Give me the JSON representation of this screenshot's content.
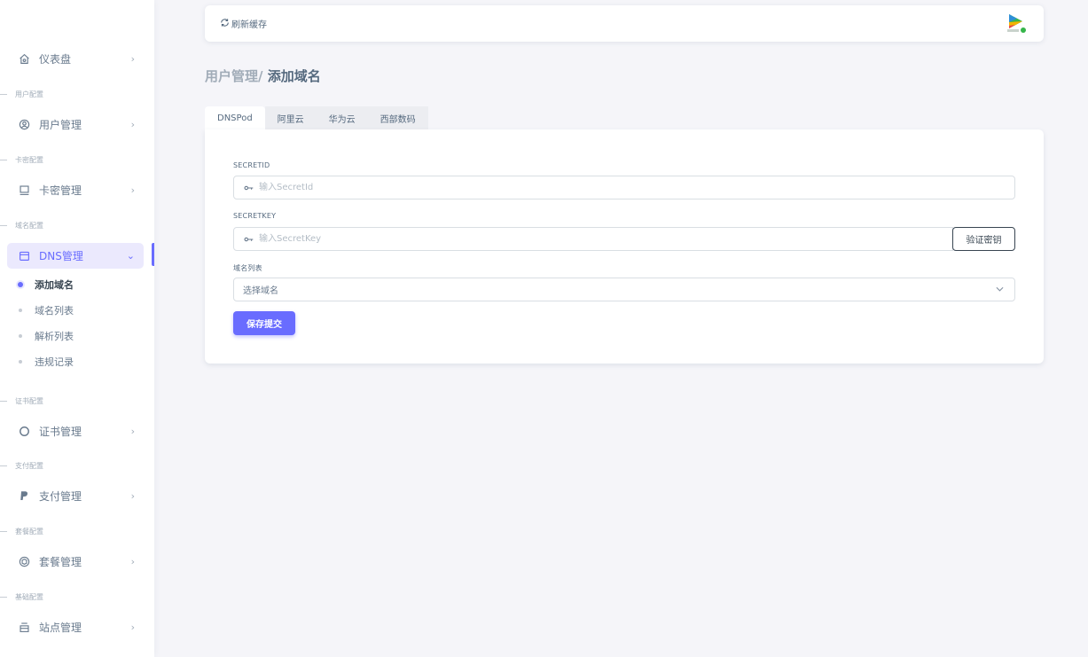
{
  "sidebar": {
    "menu": {
      "dashboard": {
        "label": "仪表盘",
        "icon": "home-icon",
        "chevron": "›"
      },
      "user": {
        "label": "用户管理",
        "icon": "user-circle-icon",
        "chevron": "›"
      },
      "card": {
        "label": "卡密管理",
        "icon": "monitor-icon",
        "chevron": "›"
      },
      "dns": {
        "label": "DNS管理",
        "icon": "calendar-icon",
        "chevron": "⌄"
      },
      "cert": {
        "label": "证书管理",
        "icon": "circle-icon",
        "chevron": "›"
      },
      "pay": {
        "label": "支付管理",
        "icon": "paypal-icon",
        "chevron": "›"
      },
      "package": {
        "label": "套餐管理",
        "icon": "package-icon",
        "chevron": "›"
      },
      "site": {
        "label": "站点管理",
        "icon": "window-icon",
        "chevron": "›"
      }
    },
    "sections": {
      "user": "用户配置",
      "card": "卡密配置",
      "domain": "域名配置",
      "cert": "证书配置",
      "pay": "支付配置",
      "package": "套餐配置",
      "base": "基础配置"
    },
    "dns_sub": [
      {
        "label": "添加域名",
        "active": true
      },
      {
        "label": "域名列表",
        "active": false
      },
      {
        "label": "解析列表",
        "active": false
      },
      {
        "label": "违规记录",
        "active": false
      }
    ]
  },
  "navbar": {
    "refresh_label": "刷新缓存",
    "avatar_icon": "play-logo-icon"
  },
  "breadcrumb": {
    "parent": "用户管理/ ",
    "current": "添加域名"
  },
  "tabs": [
    {
      "label": "DNSPod",
      "active": true
    },
    {
      "label": "阿里云",
      "active": false
    },
    {
      "label": "华为云",
      "active": false
    },
    {
      "label": "西部数码",
      "active": false
    }
  ],
  "form": {
    "secret_id_label": "SECRETID",
    "secret_id_placeholder": "输入SecretId",
    "secret_key_label": "SECRETKEY",
    "secret_key_placeholder": "输入SecretKey",
    "verify_label": "验证密钥",
    "domain_list_label": "域名列表",
    "domain_select_value": "选择域名",
    "submit_label": "保存提交"
  },
  "colors": {
    "primary": "#696cff",
    "background": "#f5f5f9",
    "text": "#566a7f"
  }
}
